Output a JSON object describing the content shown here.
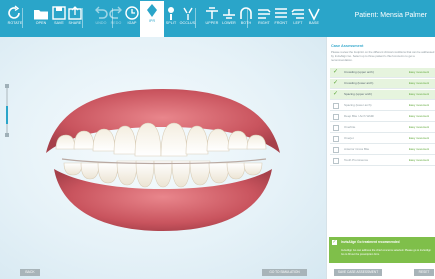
{
  "toolbar": {
    "items": [
      {
        "label": "ROTATE",
        "icon": "rotate-icon"
      },
      {
        "label": "OPEN",
        "icon": "folder-icon"
      },
      {
        "label": "SAVE",
        "icon": "save-icon"
      },
      {
        "label": "SHARE",
        "icon": "share-icon"
      },
      {
        "label": "UNDO",
        "icon": "undo-icon"
      },
      {
        "label": "REDO",
        "icon": "redo-icon"
      },
      {
        "label": "IGAP",
        "icon": "clock-icon"
      },
      {
        "label": "IPR",
        "icon": "tooth-icon"
      },
      {
        "label": "SPLIT",
        "icon": "split-icon"
      },
      {
        "label": "OCCLUS.",
        "icon": "occlusion-icon"
      },
      {
        "label": "UPPER",
        "icon": "upper-jaw-icon"
      },
      {
        "label": "LOWER",
        "icon": "lower-jaw-icon"
      },
      {
        "label": "BOTH",
        "icon": "both-jaws-icon"
      },
      {
        "label": "RIGHT",
        "icon": "right-view-icon"
      },
      {
        "label": "FRONT",
        "icon": "front-view-icon"
      },
      {
        "label": "LEFT",
        "icon": "left-view-icon"
      },
      {
        "label": "BASE",
        "icon": "base-icon"
      }
    ],
    "active_index": 7,
    "patient_label": "Patient: Mensia Palmer"
  },
  "viewport": {
    "back_label": "BACK",
    "simulation_label": "GO TO SIMULATION"
  },
  "panel": {
    "title": "Case Assessment",
    "description": "Please review the footprint on the different clinical conditions that can be addressed by InvisAlign Go. Select up to three patient's chief concerns to get a recommendation.",
    "conditions": [
      {
        "label": "Crowding (upper arch)",
        "status": "Easy movement",
        "checked": true
      },
      {
        "label": "Crowding (lower arch)",
        "status": "Easy movement",
        "checked": true
      },
      {
        "label": "Spacing (upper arch)",
        "status": "Easy movement",
        "checked": true
      },
      {
        "label": "Spacing (lower arch)",
        "status": "Easy movement",
        "checked": false
      },
      {
        "label": "Deep Bite / Arch Width",
        "status": "Easy movement",
        "checked": false
      },
      {
        "label": "Overbite",
        "status": "Easy movement",
        "checked": false
      },
      {
        "label": "Overjet",
        "status": "Easy movement",
        "checked": false
      },
      {
        "label": "Anterior Cross Bite",
        "status": "Easy movement",
        "checked": false
      },
      {
        "label": "Tooth Prominence",
        "status": "Easy movement",
        "checked": false
      }
    ],
    "recommendation_title": "InvisAlign Go treatment recommended",
    "recommendation_text": "InvisAlign Go can address the chief concerns selected. Please go to InvisAlign Go to fill out the prescription form.",
    "save_label": "SAVE CASE ASSESSMENT",
    "reset_label": "RESET"
  },
  "colors": {
    "toolbar": "#2aa5c9",
    "accent_green": "#7fbf4a",
    "button_gray": "#a8b4b9"
  }
}
